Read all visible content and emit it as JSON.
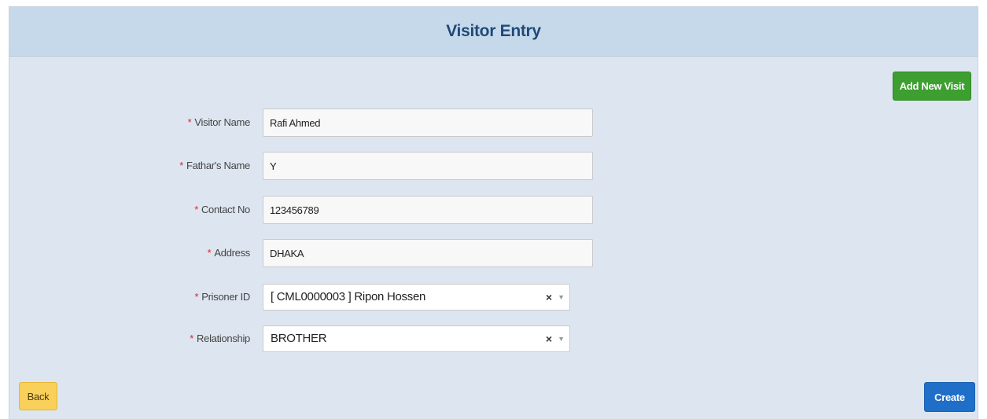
{
  "header": {
    "title": "Visitor Entry"
  },
  "actions": {
    "add_new_visit": "Add New Visit",
    "back": "Back",
    "create": "Create"
  },
  "form": {
    "required_mark": "*",
    "visitor_name": {
      "label": "Visitor Name",
      "value": "Rafi Ahmed"
    },
    "fathers_name": {
      "label": "Fathar's Name",
      "value": "Y"
    },
    "contact_no": {
      "label": "Contact No",
      "value": "123456789"
    },
    "address": {
      "label": "Address",
      "value": "DHAKA"
    },
    "prisoner_id": {
      "label": "Prisoner ID",
      "value": "[ CML0000003 ] Ripon Hossen"
    },
    "relationship": {
      "label": "Relationship",
      "value": "BROTHER"
    },
    "clear_symbol": "×",
    "dropdown_symbol": "▼"
  },
  "colors": {
    "header_bg": "#c6d9ea",
    "page_bg": "#dde6f0",
    "title": "#1e4a78",
    "add_button": "#3c9f2f",
    "back_button": "#f9d05a",
    "create_button": "#1f6fc9",
    "required": "#d9242b"
  }
}
